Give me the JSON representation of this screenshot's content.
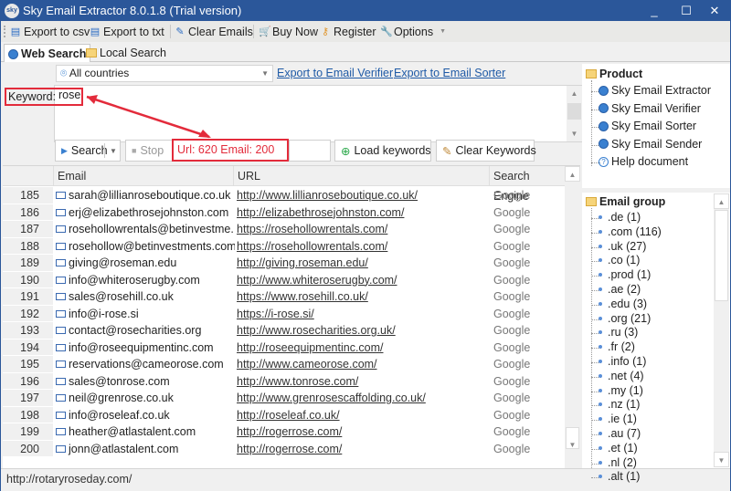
{
  "window": {
    "title": "Sky Email Extractor 8.0.1.8 (Trial version)",
    "logo_text": "sky",
    "controls": {
      "minimize": "_",
      "maximize": "☐",
      "close": "✕"
    }
  },
  "toolbar": {
    "export_csv": "Export to csv",
    "export_txt": "Export to txt",
    "clear_emails": "Clear Emails",
    "buy_now": "Buy Now",
    "register": "Register",
    "options": "Options"
  },
  "tabs": [
    {
      "label": "Web Search",
      "active": true
    },
    {
      "label": "Local Search",
      "active": false
    }
  ],
  "search": {
    "country_selected": "All countries",
    "export_verifier_link": "Export to Email Verifier",
    "export_sorter_link": "Export to Email Sorter",
    "keyword_label": "Keyword:",
    "keyword_value": "rose",
    "search_button": "Search",
    "stop_button": "Stop",
    "status_text": "Url: 620 Email: 200",
    "load_keywords_button": "Load keywords",
    "clear_keywords_button": "Clear Keywords"
  },
  "grid": {
    "columns": [
      "Email",
      "URL",
      "Search Engine"
    ],
    "rows": [
      {
        "n": "185",
        "email": "sarah@lillianroseboutique.co.uk",
        "url": "http://www.lillianroseboutique.co.uk/",
        "engine": "Google"
      },
      {
        "n": "186",
        "email": "erj@elizabethrosejohnston.com",
        "url": "http://elizabethrosejohnston.com/",
        "engine": "Google"
      },
      {
        "n": "187",
        "email": "rosehollowrentals@betinvestme...",
        "url": "https://rosehollowrentals.com/",
        "engine": "Google"
      },
      {
        "n": "188",
        "email": "rosehollow@betinvestments.com",
        "url": "https://rosehollowrentals.com/",
        "engine": "Google"
      },
      {
        "n": "189",
        "email": "giving@roseman.edu",
        "url": "http://giving.roseman.edu/",
        "engine": "Google"
      },
      {
        "n": "190",
        "email": "info@whiteroserugby.com",
        "url": "http://www.whiteroserugby.com/",
        "engine": "Google"
      },
      {
        "n": "191",
        "email": "sales@rosehill.co.uk",
        "url": "https://www.rosehill.co.uk/",
        "engine": "Google"
      },
      {
        "n": "192",
        "email": "info@i-rose.si",
        "url": "https://i-rose.si/",
        "engine": "Google"
      },
      {
        "n": "193",
        "email": "contact@rosecharities.org",
        "url": "http://www.rosecharities.org.uk/",
        "engine": "Google"
      },
      {
        "n": "194",
        "email": "info@roseequipmentinc.com",
        "url": "http://roseequipmentinc.com/",
        "engine": "Google"
      },
      {
        "n": "195",
        "email": "reservations@cameorose.com",
        "url": "http://www.cameorose.com/",
        "engine": "Google"
      },
      {
        "n": "196",
        "email": "sales@tonrose.com",
        "url": "http://www.tonrose.com/",
        "engine": "Google"
      },
      {
        "n": "197",
        "email": "neil@grenrose.co.uk",
        "url": "http://www.grenrosescaffolding.co.uk/",
        "engine": "Google"
      },
      {
        "n": "198",
        "email": "info@roseleaf.co.uk",
        "url": "http://roseleaf.co.uk/",
        "engine": "Google"
      },
      {
        "n": "199",
        "email": "heather@atlastalent.com",
        "url": "http://rogerrose.com/",
        "engine": "Google"
      },
      {
        "n": "200",
        "email": "jonn@atlastalent.com",
        "url": "http://rogerrose.com/",
        "engine": "Google"
      }
    ]
  },
  "statusbar": {
    "text": "http://rotaryroseday.com/"
  },
  "product_tree": {
    "title": "Product",
    "items": [
      "Sky Email Extractor",
      "Sky Email Verifier",
      "Sky Email Sorter",
      "Sky Email Sender",
      "Help document"
    ]
  },
  "email_group": {
    "title": "Email group",
    "items": [
      ".de (1)",
      ".com (116)",
      ".uk (27)",
      ".co (1)",
      ".prod (1)",
      ".ae (2)",
      ".edu (3)",
      ".org (21)",
      ".ru (3)",
      ".fr (2)",
      ".info (1)",
      ".net (4)",
      ".my (1)",
      ".nz (1)",
      ".ie (1)",
      ".au (7)",
      ".et (1)",
      ".nl (2)",
      ".alt (1)"
    ]
  },
  "colors": {
    "titlebar": "#2b579a",
    "annotation": "#e32b3b",
    "link": "#1f5aa6"
  }
}
